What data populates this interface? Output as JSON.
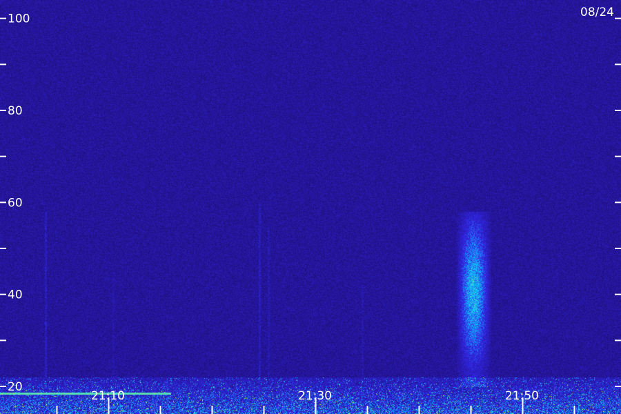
{
  "chart_data": {
    "type": "heatmap",
    "title": "",
    "xlabel": "",
    "ylabel": "",
    "date_label": "08/24",
    "y_axis": {
      "range": [
        14,
        104
      ],
      "ticks": [
        100,
        90,
        80,
        70,
        60,
        50,
        40,
        30,
        20,
        10
      ],
      "labels": [
        {
          "value": 100,
          "text": "100"
        },
        {
          "value": 80,
          "text": "80"
        },
        {
          "value": 60,
          "text": "60"
        },
        {
          "value": 40,
          "text": "40"
        },
        {
          "value": 20,
          "text": "20"
        }
      ]
    },
    "x_axis": {
      "range_minutes": [
        1259.5,
        1319.5
      ],
      "tick_minutes": [
        1265,
        1270,
        1275,
        1280,
        1285,
        1290,
        1295,
        1300,
        1305,
        1310,
        1315
      ],
      "major_tick_minutes": [
        1270,
        1290,
        1310
      ],
      "labels": [
        {
          "minute": 1270,
          "text": "21:10"
        },
        {
          "minute": 1290,
          "text": "21:30"
        },
        {
          "minute": 1310,
          "text": "21:50"
        }
      ]
    },
    "features": [
      {
        "kind": "burst",
        "minute_start": 1303.5,
        "minute_end": 1307.0,
        "freq_low": 20,
        "freq_high": 58,
        "intensity": 0.9
      },
      {
        "kind": "streak",
        "minute": 1263.9,
        "freq_low": 22,
        "freq_high": 58,
        "intensity": 0.55
      },
      {
        "kind": "streak",
        "minute": 1284.6,
        "freq_low": 22,
        "freq_high": 60,
        "intensity": 0.5
      },
      {
        "kind": "streak",
        "minute": 1285.4,
        "freq_low": 22,
        "freq_high": 55,
        "intensity": 0.35
      },
      {
        "kind": "streak",
        "minute": 1270.4,
        "freq_low": 22,
        "freq_high": 45,
        "intensity": 0.25
      },
      {
        "kind": "streak",
        "minute": 1294.5,
        "freq_low": 22,
        "freq_high": 42,
        "intensity": 0.25
      },
      {
        "kind": "line",
        "freq": 18.5,
        "minute_start": 1259.5,
        "minute_end": 1276.0,
        "intensity": 0.8
      },
      {
        "kind": "line",
        "freq": 13.5,
        "minute_start": 1308.5,
        "minute_end": 1319.5,
        "intensity": 0.85
      }
    ]
  }
}
